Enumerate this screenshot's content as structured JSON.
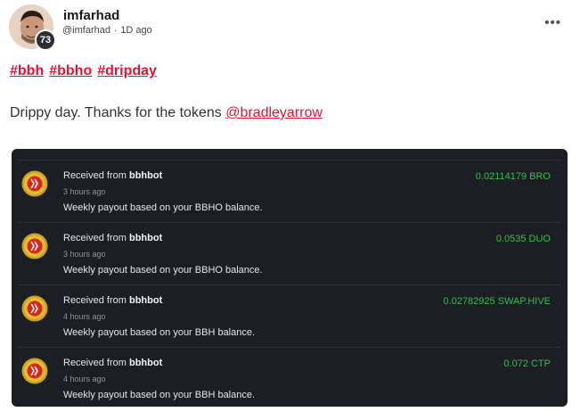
{
  "author": {
    "name": "imfarhad",
    "handle": "@imfarhad",
    "time_ago": "1D ago",
    "reputation": "73"
  },
  "menu_icon": "more-horizontal-icon",
  "tags": [
    "#bbh",
    "#bbho",
    "#dripday"
  ],
  "body": {
    "text": "Drippy day. Thanks for the tokens ",
    "mention": "@bradleyarrow"
  },
  "colors": {
    "accent": "#e31337",
    "card_bg": "#1b1f24",
    "amount": "#3fb950"
  },
  "transactions": [
    {
      "prefix": "Received from ",
      "from": "bbhbot",
      "time": "3 hours ago",
      "description": "Weekly payout based on your BBHO balance.",
      "amount": "0.02114179 BRO",
      "icon": "hive-coin-icon"
    },
    {
      "prefix": "Received from ",
      "from": "bbhbot",
      "time": "3 hours ago",
      "description": "Weekly payout based on your BBHO balance.",
      "amount": "0.0535 DUO",
      "icon": "hive-coin-icon"
    },
    {
      "prefix": "Received from ",
      "from": "bbhbot",
      "time": "4 hours ago",
      "description": "Weekly payout based on your BBH balance.",
      "amount": "0.02782925 SWAP.HIVE",
      "icon": "hive-coin-icon"
    },
    {
      "prefix": "Received from ",
      "from": "bbhbot",
      "time": "4 hours ago",
      "description": "Weekly payout based on your BBH balance.",
      "amount": "0.072 CTP",
      "icon": "hive-coin-icon"
    }
  ]
}
